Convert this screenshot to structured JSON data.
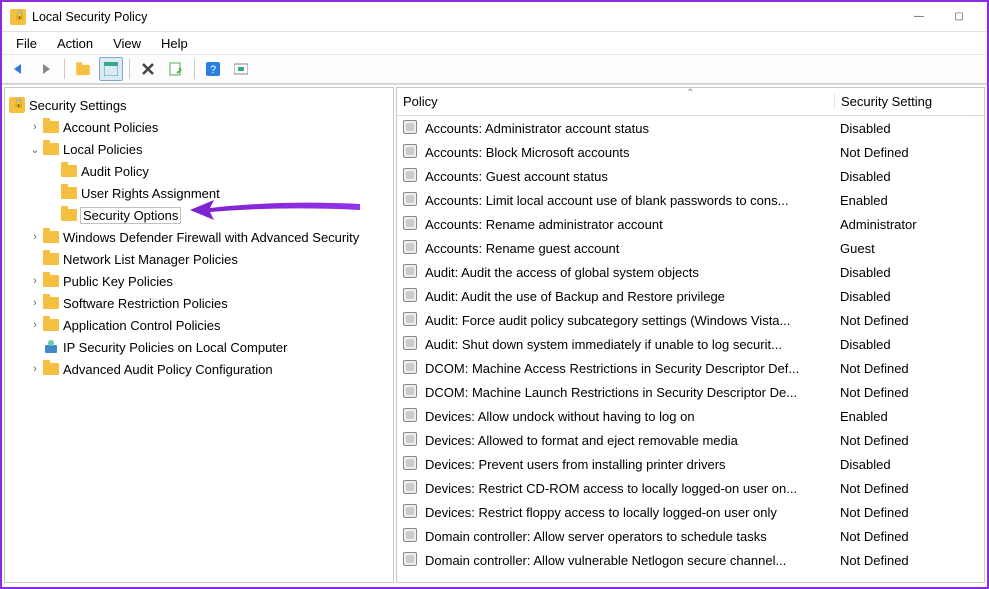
{
  "window": {
    "title": "Local Security Policy"
  },
  "menu": {
    "file": "File",
    "action": "Action",
    "view": "View",
    "help": "Help"
  },
  "tree": {
    "root": "Security Settings",
    "items": [
      {
        "label": "Account Policies",
        "depth": 1,
        "expander": "›",
        "icon": "folder"
      },
      {
        "label": "Local Policies",
        "depth": 1,
        "expander": "⌄",
        "icon": "folder",
        "expanded": true
      },
      {
        "label": "Audit Policy",
        "depth": 2,
        "expander": "",
        "icon": "folder"
      },
      {
        "label": "User Rights Assignment",
        "depth": 2,
        "expander": "",
        "icon": "folder"
      },
      {
        "label": "Security Options",
        "depth": 2,
        "expander": "",
        "icon": "folder",
        "selected": true
      },
      {
        "label": "Windows Defender Firewall with Advanced Security",
        "depth": 1,
        "expander": "›",
        "icon": "folder"
      },
      {
        "label": "Network List Manager Policies",
        "depth": 1,
        "expander": "",
        "icon": "folder"
      },
      {
        "label": "Public Key Policies",
        "depth": 1,
        "expander": "›",
        "icon": "folder"
      },
      {
        "label": "Software Restriction Policies",
        "depth": 1,
        "expander": "›",
        "icon": "folder"
      },
      {
        "label": "Application Control Policies",
        "depth": 1,
        "expander": "›",
        "icon": "folder"
      },
      {
        "label": "IP Security Policies on Local Computer",
        "depth": 1,
        "expander": "",
        "icon": "ipsec"
      },
      {
        "label": "Advanced Audit Policy Configuration",
        "depth": 1,
        "expander": "›",
        "icon": "folder"
      }
    ]
  },
  "list": {
    "col_policy": "Policy",
    "col_setting": "Security Setting",
    "rows": [
      {
        "policy": "Accounts: Administrator account status",
        "setting": "Disabled"
      },
      {
        "policy": "Accounts: Block Microsoft accounts",
        "setting": "Not Defined"
      },
      {
        "policy": "Accounts: Guest account status",
        "setting": "Disabled"
      },
      {
        "policy": "Accounts: Limit local account use of blank passwords to cons...",
        "setting": "Enabled"
      },
      {
        "policy": "Accounts: Rename administrator account",
        "setting": "Administrator"
      },
      {
        "policy": "Accounts: Rename guest account",
        "setting": "Guest"
      },
      {
        "policy": "Audit: Audit the access of global system objects",
        "setting": "Disabled"
      },
      {
        "policy": "Audit: Audit the use of Backup and Restore privilege",
        "setting": "Disabled"
      },
      {
        "policy": "Audit: Force audit policy subcategory settings (Windows Vista...",
        "setting": "Not Defined"
      },
      {
        "policy": "Audit: Shut down system immediately if unable to log securit...",
        "setting": "Disabled"
      },
      {
        "policy": "DCOM: Machine Access Restrictions in Security Descriptor Def...",
        "setting": "Not Defined"
      },
      {
        "policy": "DCOM: Machine Launch Restrictions in Security Descriptor De...",
        "setting": "Not Defined"
      },
      {
        "policy": "Devices: Allow undock without having to log on",
        "setting": "Enabled"
      },
      {
        "policy": "Devices: Allowed to format and eject removable media",
        "setting": "Not Defined"
      },
      {
        "policy": "Devices: Prevent users from installing printer drivers",
        "setting": "Disabled"
      },
      {
        "policy": "Devices: Restrict CD-ROM access to locally logged-on user on...",
        "setting": "Not Defined"
      },
      {
        "policy": "Devices: Restrict floppy access to locally logged-on user only",
        "setting": "Not Defined"
      },
      {
        "policy": "Domain controller: Allow server operators to schedule tasks",
        "setting": "Not Defined"
      },
      {
        "policy": "Domain controller: Allow vulnerable Netlogon secure channel...",
        "setting": "Not Defined"
      }
    ]
  }
}
